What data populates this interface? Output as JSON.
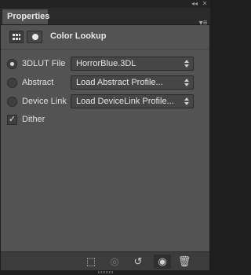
{
  "window": {
    "collapse_glyph": "◂◂",
    "close_glyph": "✕"
  },
  "tabs": [
    {
      "label": "Properties"
    }
  ],
  "panel_menu_glyph": "▾≡",
  "header": {
    "title": "Color Lookup",
    "icons": [
      "adjustment-grid-icon",
      "layer-mask-icon"
    ]
  },
  "rows": [
    {
      "label": "3DLUT File",
      "selected": true,
      "value": "HorrorBlue.3DL"
    },
    {
      "label": "Abstract",
      "selected": false,
      "value": "Load Abstract Profile..."
    },
    {
      "label": "Device Link",
      "selected": false,
      "value": "Load DeviceLink Profile..."
    }
  ],
  "dither": {
    "label": "Dither",
    "checked": true,
    "mark": "✓"
  },
  "footer": {
    "buttons": [
      {
        "name": "clip-to-layer-icon",
        "glyph": "⬚"
      },
      {
        "name": "view-previous-state-icon",
        "glyph": "◎"
      },
      {
        "name": "reset-icon",
        "glyph": "↺"
      },
      {
        "name": "visibility-eye-icon",
        "glyph": "◉"
      },
      {
        "name": "trash-icon",
        "glyph": "🗑"
      }
    ]
  },
  "colors": {
    "panel_bg": "#535353",
    "frame_bg": "#1e1e1e",
    "footer_bg": "#3c3c3c",
    "field_bg": "#464646",
    "text": "#e0e0e0"
  }
}
